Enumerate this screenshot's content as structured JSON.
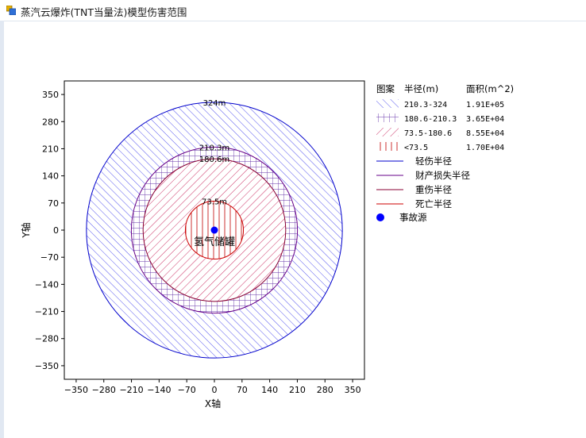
{
  "window": {
    "title": "蒸汽云爆炸(TNT当量法)模型伤害范围"
  },
  "chart_data": {
    "type": "scatter",
    "xlabel": "X轴",
    "ylabel": "Y轴",
    "xlim": [
      -380,
      380
    ],
    "ylim": [
      -385,
      385
    ],
    "xticks": [
      -350,
      -280,
      -210,
      -140,
      -70,
      0,
      70,
      140,
      210,
      280,
      350
    ],
    "yticks": [
      350,
      280,
      210,
      140,
      70,
      0,
      -70,
      -140,
      -210,
      -280,
      -350
    ],
    "circles": [
      {
        "radius": 324,
        "label": "324m",
        "color": "#0000cc"
      },
      {
        "radius": 210.3,
        "label": "210.3m",
        "color": "#660088"
      },
      {
        "radius": 180.6,
        "label": "180.6m",
        "color": "#880033"
      },
      {
        "radius": 73.5,
        "label": "73.5m",
        "color": "#cc0000"
      }
    ],
    "source": {
      "x": 0,
      "y": 0,
      "label": "氢气储罐",
      "color": "#0000ff"
    },
    "legend": {
      "headers": [
        "图案",
        "半径(m)",
        "面积(m^2)"
      ],
      "zones": [
        {
          "range": "210.3-324",
          "area": "1.91E+05",
          "color": "#5555ee"
        },
        {
          "range": "180.6-210.3",
          "area": "3.65E+04",
          "color": "#6633aa"
        },
        {
          "range": "73.5-180.6",
          "area": "8.55E+04",
          "color": "#cc3366"
        },
        {
          "range": "<73.5",
          "area": "1.70E+04",
          "color": "#cc3333"
        }
      ],
      "lines": [
        {
          "label": "轻伤半径",
          "color": "#0000cc"
        },
        {
          "label": "财产损失半径",
          "color": "#660088"
        },
        {
          "label": "重伤半径",
          "color": "#880033"
        },
        {
          "label": "死亡半径",
          "color": "#cc0000"
        }
      ],
      "source_label": "事故源"
    }
  }
}
